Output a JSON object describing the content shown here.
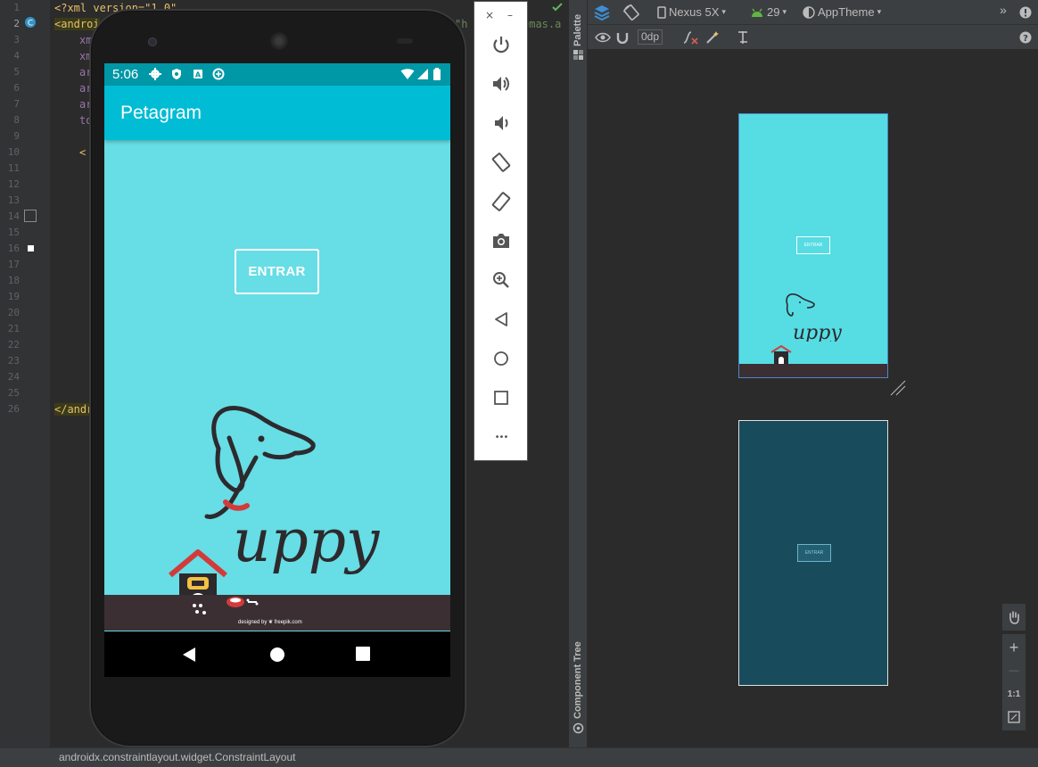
{
  "editor": {
    "line_numbers": [
      "1",
      "2",
      "3",
      "4",
      "5",
      "6",
      "7",
      "8",
      "9",
      "10",
      "11",
      "12",
      "13",
      "14",
      "15",
      "16",
      "17",
      "18",
      "19",
      "20",
      "21",
      "22",
      "23",
      "24",
      "25",
      "26"
    ],
    "current_line": "2",
    "lines": {
      "l1": "<?xml version=\"1.0\"",
      "l2_tag": "<androi",
      "l2_tail": "\"h",
      "l2_tail2": "emas.a",
      "l3": "xm",
      "l4": "xm",
      "l5": "ar",
      "l6": "ar",
      "l7": "ar",
      "l8": "to",
      "l10": "<",
      "l26": "</andr"
    }
  },
  "emulator": {
    "status_time": "5:06",
    "app_title": "Petagram",
    "button_label": "ENTRAR",
    "brand_text": "uppy",
    "credit": "designed by ❦ freepik.com",
    "toolbar": {
      "close": "×",
      "minimize": "–",
      "buttons": [
        "power-icon",
        "volume-up-icon",
        "volume-down-icon",
        "rotate-left-icon",
        "rotate-right-icon",
        "camera-icon",
        "zoom-icon",
        "back-icon",
        "home-icon",
        "overview-icon",
        "more-icon"
      ],
      "more": "•••"
    }
  },
  "design": {
    "palette_label": "Palette",
    "component_tree_label": "Component Tree",
    "device": "Nexus 5X",
    "api_level": "29",
    "theme": "AppTheme",
    "margin_value": "0dp",
    "expand": "»",
    "preview_button_label": "ENTRAR",
    "blueprint_button_label": "ENTRAR",
    "zoom_plus": "+",
    "zoom_minus": "—",
    "zoom_reset": "1:1"
  },
  "status_bar": {
    "breadcrumb": "androidx.constraintlayout.widget.ConstraintLayout"
  },
  "colors": {
    "app_bar": "#00bcd4",
    "status_bar": "#0097a7",
    "screen_bg": "#67dde5",
    "ground": "#3b2f33",
    "blueprint": "#184c5c"
  }
}
